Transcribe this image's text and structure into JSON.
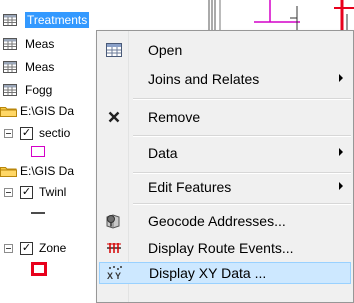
{
  "toc": {
    "items": [
      {
        "kind": "table",
        "label": "Treatments",
        "selected": true
      },
      {
        "kind": "table",
        "label": "Meas"
      },
      {
        "kind": "table",
        "label": "Meas"
      },
      {
        "kind": "table",
        "label": "Fogg"
      },
      {
        "kind": "folder",
        "label": "E:\\GIS Da"
      },
      {
        "kind": "layer",
        "label": "sectio"
      },
      {
        "kind": "folder",
        "label": "E:\\GIS Da"
      },
      {
        "kind": "layer",
        "label": "Twinl"
      },
      {
        "kind": "layer",
        "label": "Zone"
      }
    ]
  },
  "menu": {
    "items": [
      {
        "label": "Open",
        "icon": "table-icon"
      },
      {
        "label": "Joins and Relates",
        "submenu": true
      },
      {
        "label": "Remove",
        "icon": "remove-icon"
      },
      {
        "label": "Data",
        "submenu": true
      },
      {
        "label": "Edit Features",
        "submenu": true
      },
      {
        "label": "Geocode Addresses...",
        "icon": "geocode-icon"
      },
      {
        "label": "Display Route Events...",
        "icon": "route-events-icon"
      },
      {
        "label": "Display XY Data ...",
        "icon": "xy-data-icon",
        "highlighted": true
      }
    ]
  },
  "colors": {
    "selection": "#3399ff",
    "menu_highlight": "#cde8ff",
    "red_symbol": "#e8001c",
    "pink_symbol": "#d400c8"
  }
}
